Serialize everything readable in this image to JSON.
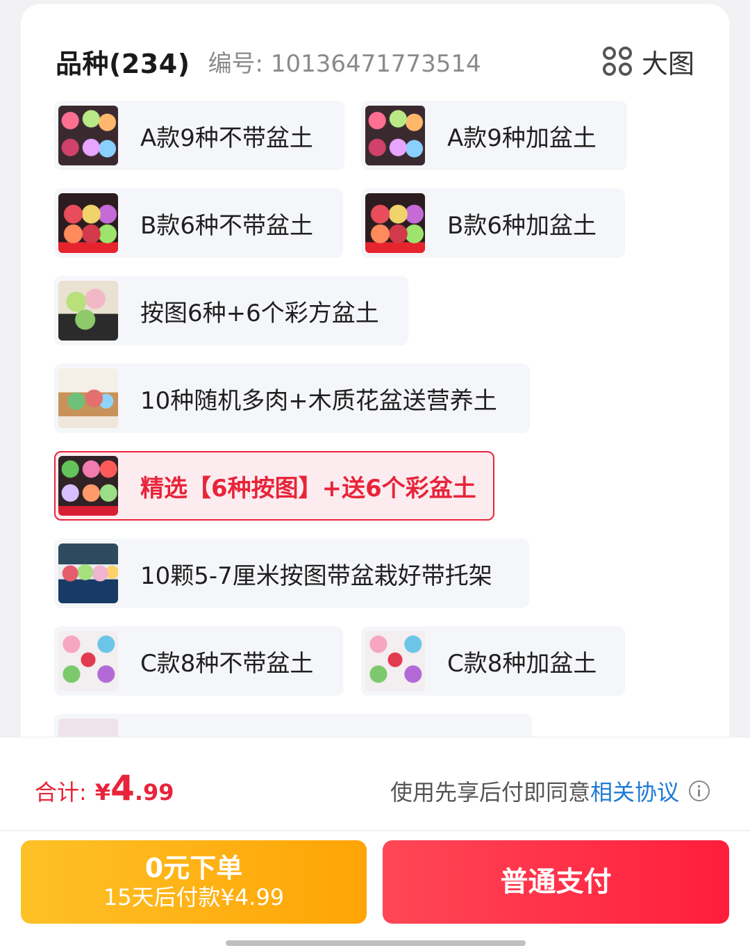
{
  "header": {
    "title": "品种(234)",
    "code": "编号: 10136471773514",
    "big_image_label": "大图"
  },
  "options": [
    {
      "label": "A款9种不带盆土",
      "thumb": "succulent-grid"
    },
    {
      "label": "A款9种加盆土",
      "thumb": "succulent-grid"
    },
    {
      "label": "B款6种不带盆土",
      "thumb": "succulent-dark"
    },
    {
      "label": "B款6种加盆土",
      "thumb": "succulent-dark"
    },
    {
      "label": "按图6种+6个彩方盆土",
      "thumb": "square-pots"
    },
    {
      "label": "10种随机多肉+木质花盆送营养土",
      "thumb": "wooden-box"
    },
    {
      "label": "精选【6种按图】+送6个彩盆土",
      "thumb": "selected-grid",
      "selected": true
    },
    {
      "label": "10颗5-7厘米按图带盆栽好带托架",
      "thumb": "rack"
    },
    {
      "label": "C款8种不带盆土",
      "thumb": "succulent-c"
    },
    {
      "label": "C款8种加盆土",
      "thumb": "succulent-c"
    },
    {
      "label": "",
      "thumb": "partial"
    }
  ],
  "footer": {
    "total_label": "合计:",
    "currency": "¥",
    "total_int": "4",
    "total_dec": ".99",
    "agree_text": "使用先享后付即同意",
    "agree_link": "相关协议",
    "paylater_main": "0元下单",
    "paylater_sub": "15天后付款¥4.99",
    "normal_pay": "普通支付"
  },
  "colors": {
    "accent_red": "#e8243a",
    "link_blue": "#1e7ad4",
    "paylater_orange": "#ffa405"
  }
}
